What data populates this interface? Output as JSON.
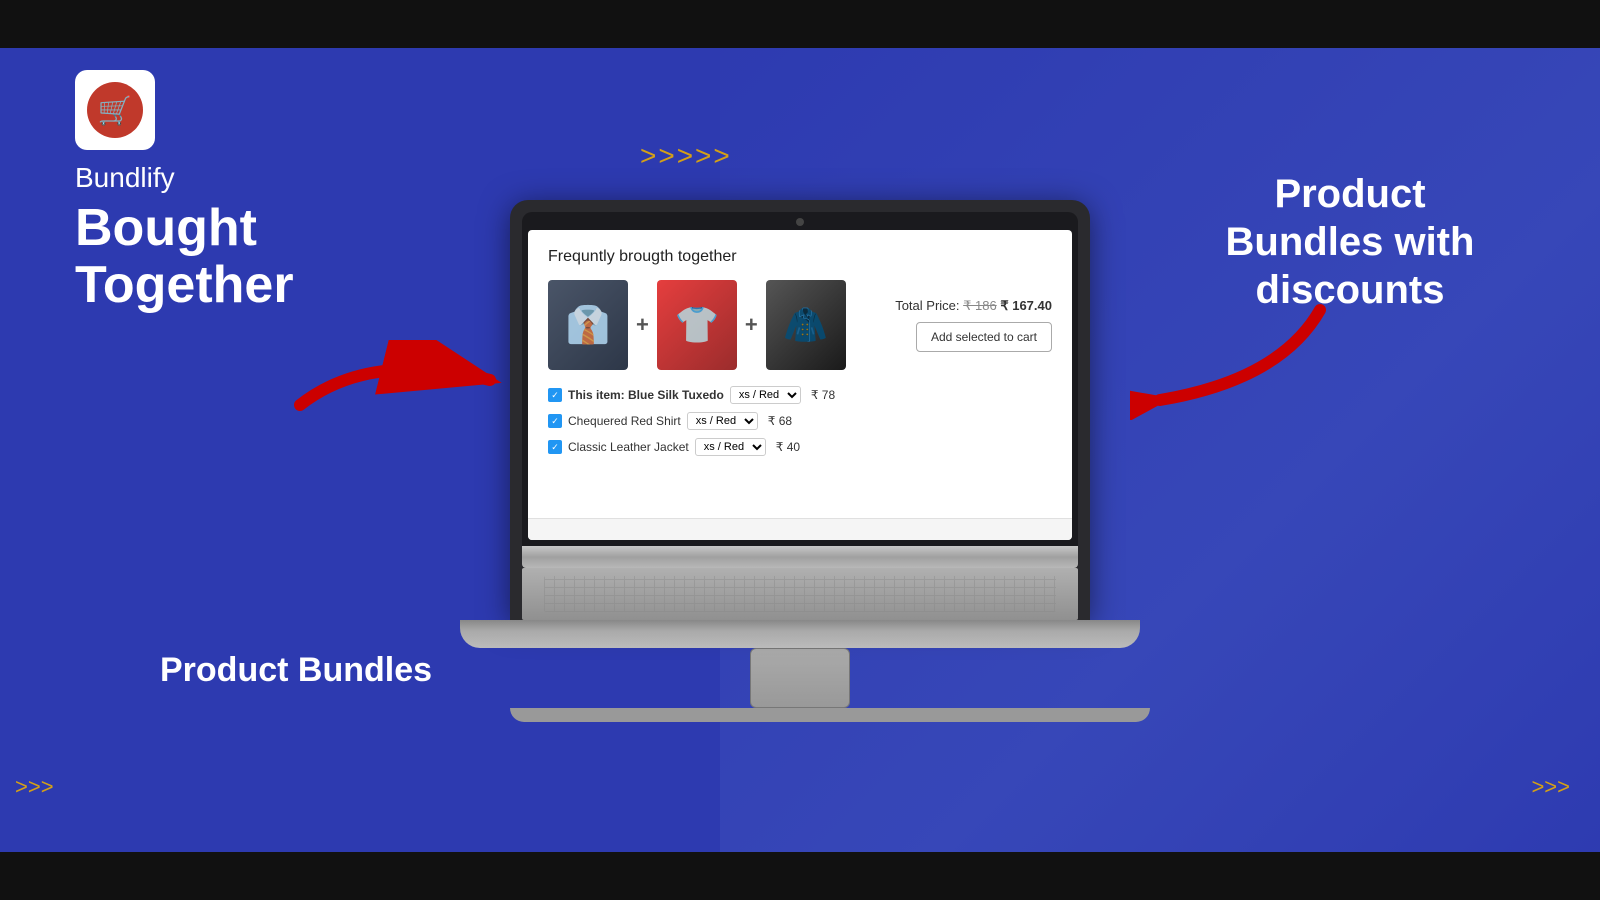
{
  "page": {
    "background_color": "#2d3ab0"
  },
  "top_bar": {
    "color": "#111"
  },
  "bottom_bar": {
    "color": "#111"
  },
  "brand": {
    "name": "Bundlify",
    "tagline_bold": "Bought Together"
  },
  "labels": {
    "product_bundles": "Product Bundles",
    "discounts_title": "Product Bundles with discounts"
  },
  "decorations": {
    "arrow_top": ">>>>>",
    "arrow_bottom_right": ">>>",
    "arrow_bottom_left": ">>>"
  },
  "laptop_screen": {
    "title": "Frequntly brougth together",
    "total_price_label": "Total Price:",
    "old_price": "₹ 186",
    "new_price": "₹ 167.40",
    "add_to_cart_label": "Add selected to cart",
    "items": [
      {
        "checked": true,
        "label": "This item: Blue Silk Tuxedo",
        "variant": "xs / Red",
        "price": "₹ 78",
        "color_class": "tuxedo"
      },
      {
        "checked": true,
        "label": "Chequered Red Shirt",
        "variant": "xs / Red",
        "price": "₹ 68",
        "color_class": "shirt"
      },
      {
        "checked": true,
        "label": "Classic Leather Jacket",
        "variant": "xs / Red",
        "price": "₹ 40",
        "color_class": "jacket"
      }
    ]
  }
}
